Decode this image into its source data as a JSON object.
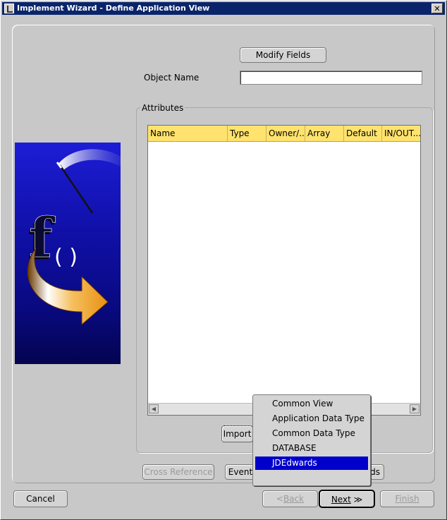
{
  "window": {
    "title": "Implement Wizard - Define Application View",
    "close_glyph": "✕"
  },
  "form": {
    "modify_fields_label": "Modify Fields",
    "object_name_label": "Object Name",
    "object_name_value": "",
    "attributes_group_label": "Attributes"
  },
  "table": {
    "columns": [
      "Name",
      "Type",
      "Owner/...",
      "Array",
      "Default",
      "IN/OUT..."
    ],
    "rows": []
  },
  "actions": {
    "import_label": "Import",
    "cross_reference_label": "Cross Reference",
    "event_label": "Event",
    "hidden_button_tail": "ds"
  },
  "popup_menu": {
    "items": [
      "Common View",
      "Application Data Type",
      "Common Data Type",
      "DATABASE",
      "JDEdwards"
    ],
    "selected": "JDEdwards"
  },
  "footer": {
    "cancel_label": "Cancel",
    "back_prefix": "<",
    "back_label": "Back",
    "next_label": "Next",
    "next_suffix": "≫",
    "finish_label": "Finish"
  },
  "colors": {
    "titlebar": "#0a246a",
    "table_header": "#ffe36e",
    "menu_selection": "#0000cc",
    "panel_blue": "#1010a8",
    "arrow_orange": "#f0a020"
  },
  "icons": {
    "wizard_graphic": "function-arrow-graphic",
    "close": "close-icon"
  }
}
